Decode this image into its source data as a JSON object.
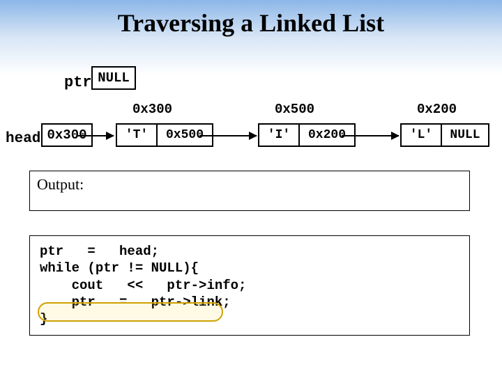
{
  "title": "Traversing a Linked List",
  "ptr_label": "ptr",
  "null_label": "NULL",
  "head_label": "head",
  "head_value": "0x300",
  "addresses": {
    "a1": "0x300",
    "a2": "0x500",
    "a3": "0x200"
  },
  "nodes": {
    "n1": {
      "info": "'T'",
      "link": "0x500"
    },
    "n2": {
      "info": "'I'",
      "link": "0x200"
    },
    "n3": {
      "info": "'L'",
      "link": "NULL"
    }
  },
  "output_label": "Output:",
  "code": "ptr   =   head;\nwhile (ptr != NULL){\n    cout   <<   ptr->info;\n    ptr   =   ptr->link;\n}"
}
